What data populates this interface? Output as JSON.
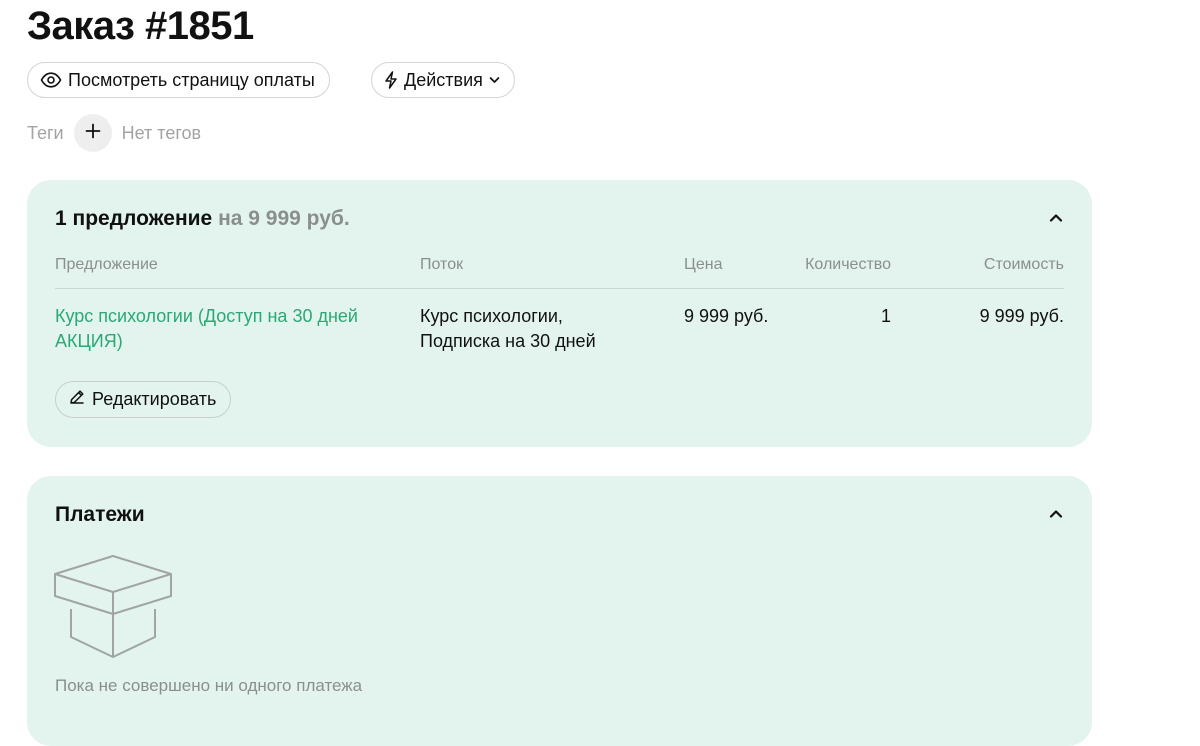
{
  "page": {
    "title": "Заказ #1851"
  },
  "toolbar": {
    "view_payment_label": "Посмотреть страницу оплаты",
    "actions_label": "Действия"
  },
  "tags": {
    "label": "Теги",
    "empty_text": "Нет тегов"
  },
  "offers_card": {
    "title": "1 предложение",
    "total": "на 9 999 руб.",
    "columns": [
      "Предложение",
      "Поток",
      "Цена",
      "Количество",
      "Стоимость"
    ],
    "rows": [
      {
        "offer_line1": "Курс психологии (Доступ на 30 дней",
        "offer_line2": "АКЦИЯ)",
        "stream_line1": "Курс психологии,",
        "stream_line2": "Подписка на 30 дней",
        "price": "9 999 руб.",
        "quantity": "1",
        "cost": "9 999 руб."
      }
    ],
    "edit_label": "Редактировать"
  },
  "payments_card": {
    "title": "Платежи",
    "empty_text": "Пока не совершено ни одного платежа"
  },
  "colors": {
    "card_bg": "#e3f4ee",
    "accent_link": "#2aa876",
    "muted_text": "#8a8f8d"
  },
  "icons": [
    "eye-icon",
    "lightning-icon",
    "chevron-down-icon",
    "plus-icon",
    "chevron-up-icon",
    "pencil-icon",
    "empty-box-icon"
  ]
}
